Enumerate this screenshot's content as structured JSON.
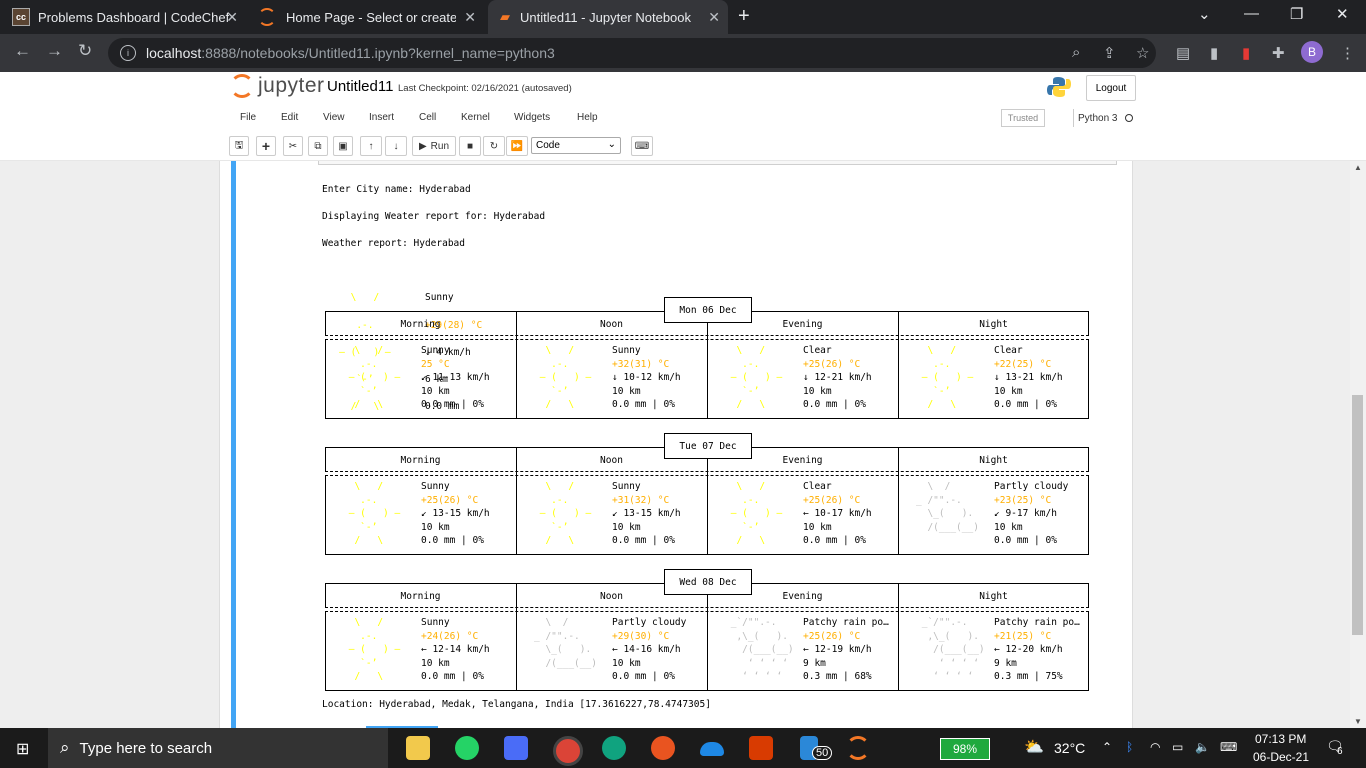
{
  "browser": {
    "tabs": [
      {
        "title": "Problems Dashboard | CodeChef",
        "favicon": "codechef-icon"
      },
      {
        "title": "Home Page - Select or create a n",
        "favicon": "jupyter-icon"
      },
      {
        "title": "Untitled11 - Jupyter Notebook",
        "favicon": "notebook-icon"
      }
    ],
    "url_host": "localhost",
    "url_rest": ":8888/notebooks/Untitled11.ipynb?kernel_name=python3",
    "profile_initial": "B"
  },
  "jupyter": {
    "logo_text": "jupyter",
    "notebook_title": "Untitled11",
    "checkpoint": "Last Checkpoint: 02/16/2021  (autosaved)",
    "logout_label": "Logout",
    "menu": [
      "File",
      "Edit",
      "View",
      "Insert",
      "Cell",
      "Kernel",
      "Widgets",
      "Help"
    ],
    "trusted_label": "Trusted",
    "kernel_label": "Python 3",
    "run_label": "Run",
    "cell_type": "Code"
  },
  "output": {
    "intro": [
      "Enter City name: Hyderabad",
      "Displaying Weater report for: Hyderabad",
      "Weather report: Hyderabad"
    ],
    "current": {
      "condition": "Sunny",
      "temp": "+29(28) °C",
      "wind": "↓ 4 km/h",
      "visibility": "6 km",
      "precip": "0.0 mm"
    },
    "period_headers": [
      "Morning",
      "Noon",
      "Evening",
      "Night"
    ],
    "days": [
      {
        "date": "Mon 06 Dec",
        "periods": [
          {
            "cond": "Sunny",
            "temp": "25 °C",
            "wind": "↙ 11-13 km/h",
            "vis": "10 km",
            "precip": "0.0 mm | 0%"
          },
          {
            "cond": "Sunny",
            "temp": "+32(31) °C",
            "wind": "↓ 10-12 km/h",
            "vis": "10 km",
            "precip": "0.0 mm | 0%"
          },
          {
            "cond": "Clear",
            "temp": "+25(26) °C",
            "wind": "↓ 12-21 km/h",
            "vis": "10 km",
            "precip": "0.0 mm | 0%"
          },
          {
            "cond": "Clear",
            "temp": "+22(25) °C",
            "wind": "↓ 13-21 km/h",
            "vis": "10 km",
            "precip": "0.0 mm | 0%"
          }
        ]
      },
      {
        "date": "Tue 07 Dec",
        "periods": [
          {
            "cond": "Sunny",
            "temp": "+25(26) °C",
            "wind": "↙ 13-15 km/h",
            "vis": "10 km",
            "precip": "0.0 mm | 0%"
          },
          {
            "cond": "Sunny",
            "temp": "+31(32) °C",
            "wind": "↙ 13-15 km/h",
            "vis": "10 km",
            "precip": "0.0 mm | 0%"
          },
          {
            "cond": "Clear",
            "temp": "+25(26) °C",
            "wind": "← 10-17 km/h",
            "vis": "10 km",
            "precip": "0.0 mm | 0%"
          },
          {
            "cond": "Partly cloudy",
            "temp": "+23(25) °C",
            "wind": "↙ 9-17 km/h",
            "vis": "10 km",
            "precip": "0.0 mm | 0%"
          }
        ]
      },
      {
        "date": "Wed 08 Dec",
        "periods": [
          {
            "cond": "Sunny",
            "temp": "+24(26) °C",
            "wind": "← 12-14 km/h",
            "vis": "10 km",
            "precip": "0.0 mm | 0%"
          },
          {
            "cond": "Partly cloudy",
            "temp": "+29(30) °C",
            "wind": "← 14-16 km/h",
            "vis": "10 km",
            "precip": "0.0 mm | 0%"
          },
          {
            "cond": "Patchy rain po…",
            "temp": "+25(26) °C",
            "wind": "← 12-19 km/h",
            "vis": "9 km",
            "precip": "0.3 mm | 68%"
          },
          {
            "cond": "Patchy rain po…",
            "temp": "+21(25) °C",
            "wind": "← 12-20 km/h",
            "vis": "9 km",
            "precip": "0.3 mm | 75%"
          }
        ]
      }
    ],
    "location": "Location: Hyderabad, Medak, Telangana, India [17.3616227,78.4747305]"
  },
  "taskbar": {
    "search_placeholder": "Type here to search",
    "battery": "98%",
    "weather": "32°C",
    "time": "07:13 PM",
    "date": "06-Dec-21",
    "notifications": "6",
    "badge_count": "50"
  }
}
